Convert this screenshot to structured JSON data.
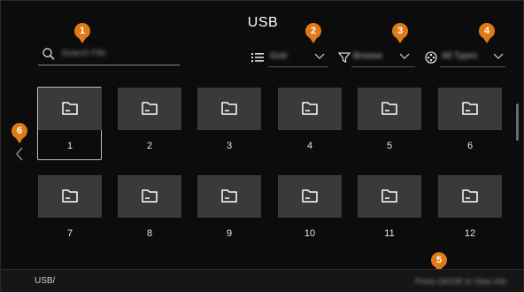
{
  "header": {
    "title": "USB"
  },
  "search": {
    "placeholder": "Search File"
  },
  "controls": {
    "view": {
      "label": "Grid",
      "icon": "list-icon"
    },
    "filter": {
      "label": "Browse",
      "icon": "filter-icon"
    },
    "device": {
      "label": "All Types",
      "icon": "media-icon"
    }
  },
  "callouts": [
    "1",
    "2",
    "3",
    "4",
    "5",
    "6"
  ],
  "folders": [
    {
      "label": "1"
    },
    {
      "label": "2"
    },
    {
      "label": "3"
    },
    {
      "label": "4"
    },
    {
      "label": "5"
    },
    {
      "label": "6"
    },
    {
      "label": "7"
    },
    {
      "label": "8"
    },
    {
      "label": "9"
    },
    {
      "label": "10"
    },
    {
      "label": "11"
    },
    {
      "label": "12"
    }
  ],
  "footer": {
    "path": "USB/",
    "hint": "Press OK/OK to View Info"
  },
  "colors": {
    "accent": "#e07a18",
    "tile": "#3a3a3a",
    "background": "#0c0c0c"
  }
}
